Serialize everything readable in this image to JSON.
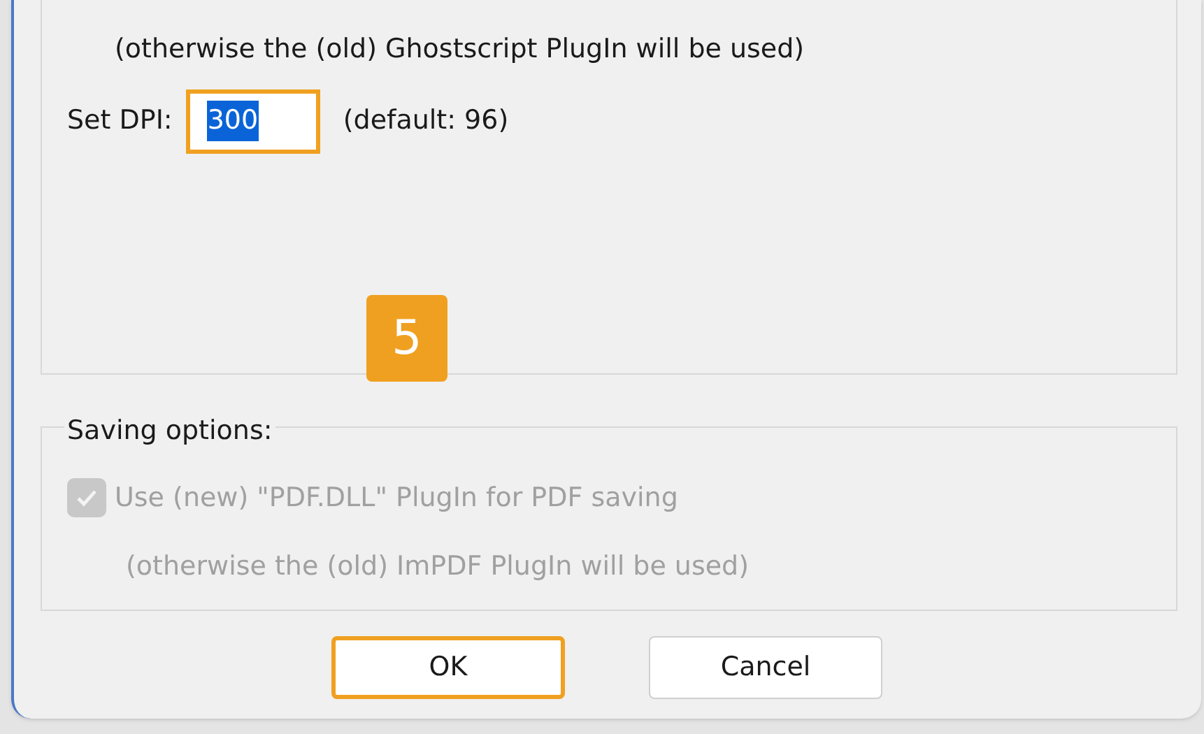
{
  "ghostscript_note": "(otherwise the (old) Ghostscript PlugIn will be used)",
  "dpi": {
    "label": "Set DPI:",
    "value": "300",
    "value_selected": true,
    "highlighted": true,
    "hint": "(default: 96)"
  },
  "callout": "5",
  "saving_options": {
    "title": "Saving options:",
    "checkbox": {
      "label": "Use (new) \"PDF.DLL\" PlugIn for PDF saving",
      "checked": true,
      "disabled": true
    },
    "note": "(otherwise the (old) ImPDF PlugIn will be used)"
  },
  "buttons": [
    {
      "label": "OK",
      "highlighted": true
    },
    {
      "label": "Cancel",
      "highlighted": false
    }
  ]
}
